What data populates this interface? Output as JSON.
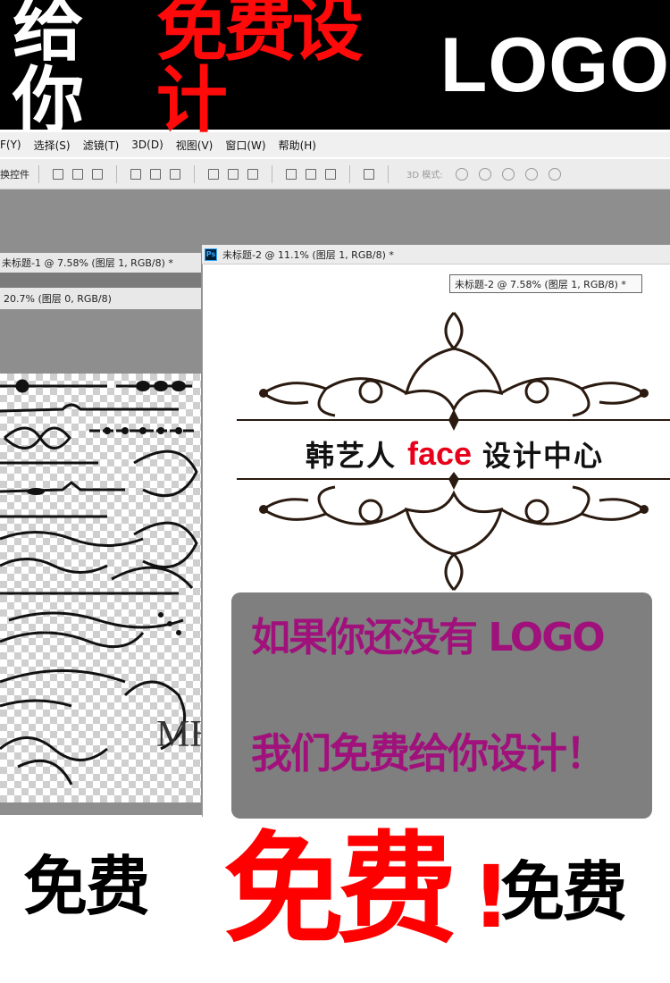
{
  "banner": {
    "white1": "给你",
    "red": "免费设计",
    "logo": "LOGO"
  },
  "menu": [
    "F(Y)",
    "选择(S)",
    "滤镜(T)",
    "3D(D)",
    "视图(V)",
    "窗口(W)",
    "帮助(H)"
  ],
  "toolbar": {
    "label": "换控件",
    "mode_label": "3D 模式:"
  },
  "windows": {
    "doc1_tab": "未标题-1 @ 7.58% (图层 1, RGB/8) *",
    "doc0_tab": "20.7% (图层 0, RGB/8)",
    "doc2_tab": "未标题-2 @ 11.1% (图层 1, RGB/8) *",
    "tooltip": "未标题-2 @ 7.58% (图层 1, RGB/8) *",
    "ps_label": "Ps",
    "canvas_text": "MH"
  },
  "logo_text": {
    "cn_left": "韩艺人",
    "en": "face",
    "cn_right": "设计中心"
  },
  "promo": {
    "line1": "如果你还没有 LOGO",
    "line2": "我们免费给你设计！"
  },
  "bottom": {
    "left": "免费",
    "big": "免费",
    "exclaim": "!",
    "right": "免费"
  },
  "colors": {
    "accent_red": "#ff0a0a",
    "promo_text": "#a0117c",
    "face_red": "#e8001a"
  }
}
